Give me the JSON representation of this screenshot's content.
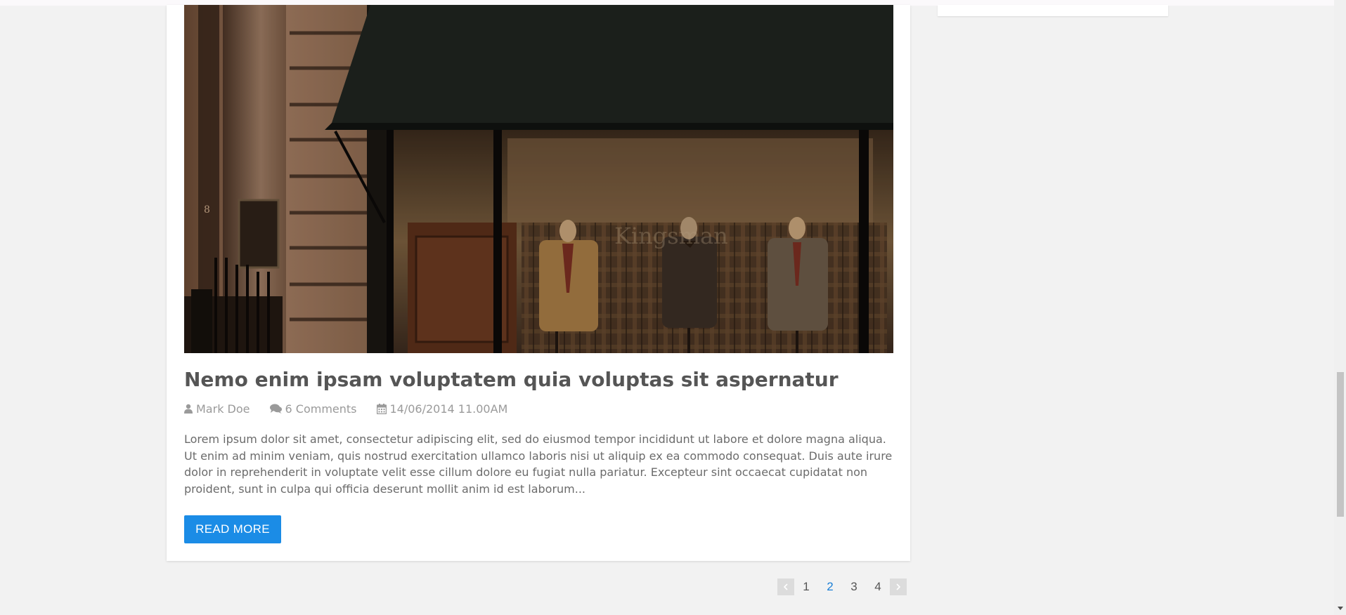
{
  "post": {
    "title": "Nemo enim ipsam voluptatem quia voluptas sit aspernatur",
    "author": "Mark Doe",
    "comments": "6 Comments",
    "date": "14/06/2014 11.00AM",
    "excerpt": "Lorem ipsum dolor sit amet, consectetur adipiscing elit, sed do eiusmod tempor incididunt ut labore et dolore magna aliqua. Ut enim ad minim veniam, quis nostrud exercitation ullamco laboris nisi ut aliquip ex ea commodo consequat. Duis aute irure dolor in reprehenderit in voluptate velit esse cillum dolore eu fugiat nulla pariatur. Excepteur sint occaecat cupidatat non proident, sunt in culpa qui officia deserunt mollit anim id est laborum...",
    "read_more_label": "READ MORE",
    "image_icon": "tailor-shop-window-photo",
    "author_icon": "user-icon",
    "comments_icon": "comments-icon",
    "date_icon": "calendar-icon"
  },
  "pagination": {
    "prev_icon": "chevron-left-icon",
    "next_icon": "chevron-right-icon",
    "pages": [
      "1",
      "2",
      "3",
      "4"
    ],
    "active_page": "2"
  },
  "colors": {
    "accent": "#1b8ce6",
    "background": "#f2f2f2",
    "title": "#555555",
    "meta": "#9a9a9a"
  }
}
